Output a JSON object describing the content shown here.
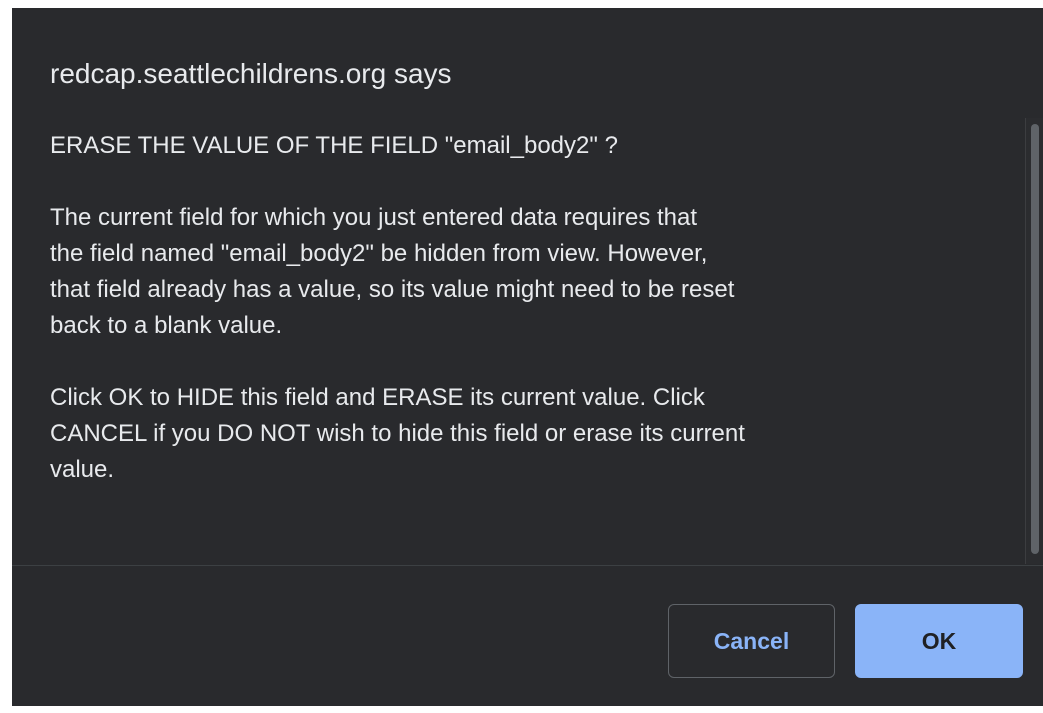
{
  "dialog": {
    "title": "redcap.seattlechildrens.org says",
    "message": {
      "heading": "ERASE THE VALUE OF THE FIELD \"email_body2\" ?",
      "paragraph1": "The current field for which you just entered data requires that\nthe field named \"email_body2\" be hidden from view. However,\nthat field already has a value, so its value might need to be reset\nback to a blank value.",
      "paragraph2": "Click OK to HIDE this field and ERASE its current value. Click\nCANCEL if you DO NOT wish to hide this field or erase its current\nvalue."
    },
    "buttons": {
      "cancel_label": "Cancel",
      "ok_label": "OK"
    }
  },
  "colors": {
    "dialog_background": "#292a2d",
    "text": "#e8eaed",
    "accent": "#8ab4f8",
    "ok_text": "#202124"
  }
}
